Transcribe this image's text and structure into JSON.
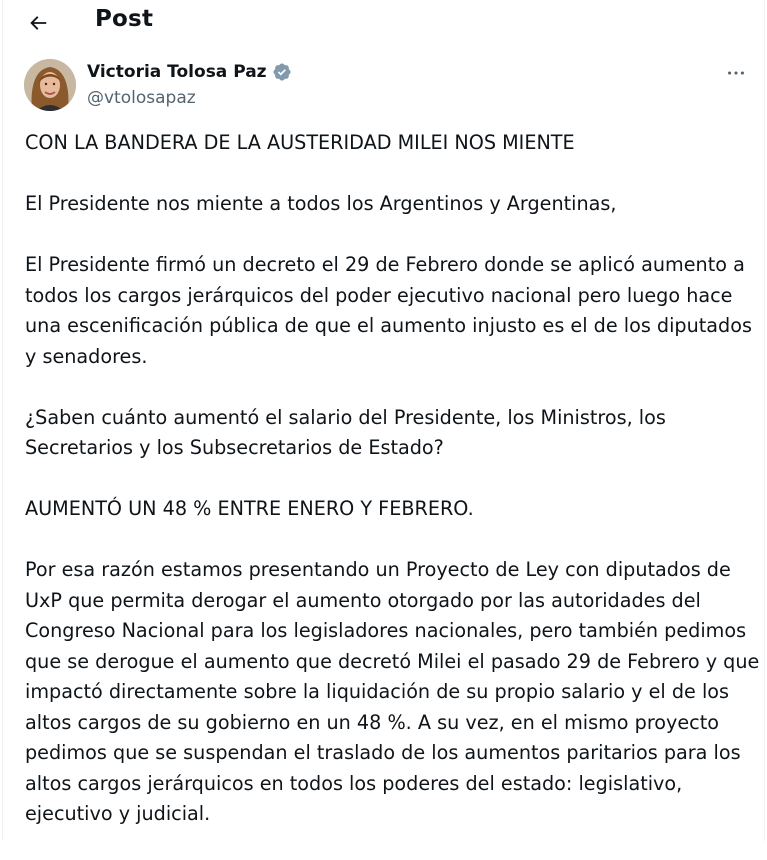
{
  "header": {
    "title": "Post",
    "back_icon": "arrow-left-icon"
  },
  "author": {
    "name": "Victoria Tolosa Paz",
    "handle": "@vtolosapaz",
    "verified_icon": "verified-badge-icon",
    "verified_color": "#1d9bf0",
    "more_icon": "more-horizontal-icon"
  },
  "post": {
    "paragraphs": [
      "CON LA BANDERA DE LA AUSTERIDAD MILEI NOS MIENTE",
      "El Presidente nos miente a todos los Argentinos y Argentinas,",
      "El Presidente firmó un decreto el 29 de Febrero donde se aplicó aumento a todos los cargos jerárquicos del poder ejecutivo nacional pero luego hace una escenificación pública de que el aumento injusto es el de los diputados y senadores.",
      "¿Saben cuánto aumentó el salario del Presidente, los Ministros, los Secretarios y los Subsecretarios de Estado?",
      "AUMENTÓ UN 48 % ENTRE ENERO Y FEBRERO.",
      "Por esa razón estamos presentando un Proyecto de Ley con diputados de UxP que permita derogar el aumento otorgado por las autoridades del Congreso Nacional para los legisladores nacionales, pero también pedimos que se derogue el aumento que decretó Milei el pasado 29 de Febrero y que impactó directamente sobre la liquidación de su propio salario y el de los altos cargos de su gobierno en un 48 %. A su vez, en el mismo proyecto pedimos que se suspendan el traslado de los aumentos paritarios para los altos cargos jerárquicos en todos los poderes del estado: legislativo, ejecutivo y judicial."
    ]
  }
}
